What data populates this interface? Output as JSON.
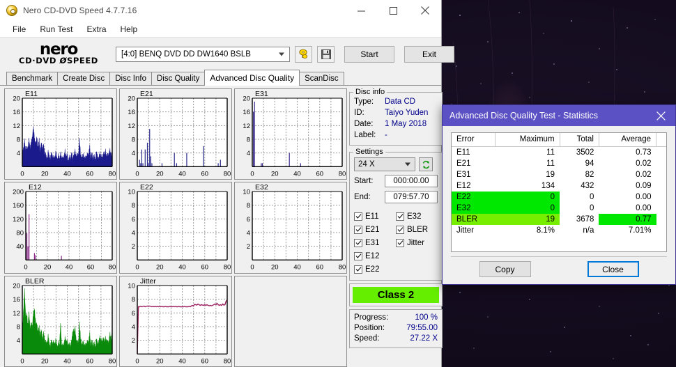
{
  "window": {
    "title": "Nero CD-DVD Speed 4.7.7.16",
    "icon": "nero-disc-icon",
    "minimize": "minimize-icon",
    "maximize": "maximize-icon",
    "close": "close-icon"
  },
  "menu": {
    "items": [
      {
        "label": "File"
      },
      {
        "label": "Run Test"
      },
      {
        "label": "Extra"
      },
      {
        "label": "Help"
      }
    ]
  },
  "logo": {
    "line1": "nero",
    "line2_left": "CD·DVD",
    "line2_right": "SPEED"
  },
  "toolbar": {
    "drive": "[4:0]   BENQ DVD DD DW1640 BSLB",
    "eject_icon": "disc-eject-icon",
    "save_icon": "floppy-save-icon",
    "start_label": "Start",
    "exit_label": "Exit"
  },
  "tabs": [
    {
      "label": "Benchmark",
      "active": false
    },
    {
      "label": "Create Disc",
      "active": false
    },
    {
      "label": "Disc Info",
      "active": false
    },
    {
      "label": "Disc Quality",
      "active": false
    },
    {
      "label": "Advanced Disc Quality",
      "active": true
    },
    {
      "label": "ScanDisc",
      "active": false
    }
  ],
  "disc_info": {
    "legend": "Disc info",
    "type_label": "Type:",
    "type_value": "Data CD",
    "id_label": "ID:",
    "id_value": "Taiyo Yuden",
    "date_label": "Date:",
    "date_value": "1 May 2018",
    "label_label": "Label:",
    "label_value": "-"
  },
  "settings": {
    "legend": "Settings",
    "speed": "24 X",
    "refresh_icon": "refresh-icon",
    "start_label": "Start:",
    "start_value": "000:00.00",
    "end_label": "End:",
    "end_value": "079:57.70",
    "checks_left": [
      {
        "label": "E11",
        "checked": true
      },
      {
        "label": "E21",
        "checked": true
      },
      {
        "label": "E31",
        "checked": true
      },
      {
        "label": "E12",
        "checked": true
      },
      {
        "label": "E22",
        "checked": true
      }
    ],
    "checks_right": [
      {
        "label": "E32",
        "checked": true
      },
      {
        "label": "BLER",
        "checked": true
      },
      {
        "label": "Jitter",
        "checked": true
      }
    ]
  },
  "class_badge": {
    "label": "Class 2",
    "color": "#66ee00"
  },
  "status": {
    "progress_label": "Progress:",
    "progress_value": "100 %",
    "position_label": "Position:",
    "position_value": "79:55.00",
    "speed_label": "Speed:",
    "speed_value": "27.22 X"
  },
  "dialog": {
    "title": "Advanced Disc Quality Test - Statistics",
    "close_icon": "close-icon",
    "title_color": "#5b51c4",
    "columns": [
      "Error",
      "Maximum",
      "Total",
      "Average"
    ],
    "rows": [
      {
        "error": "E11",
        "maximum": "11",
        "total": "3502",
        "average": "0.73",
        "highlight": "none"
      },
      {
        "error": "E21",
        "maximum": "11",
        "total": "94",
        "average": "0.02",
        "highlight": "none"
      },
      {
        "error": "E31",
        "maximum": "19",
        "total": "82",
        "average": "0.02",
        "highlight": "none"
      },
      {
        "error": "E12",
        "maximum": "134",
        "total": "432",
        "average": "0.09",
        "highlight": "none"
      },
      {
        "error": "E22",
        "maximum": "0",
        "total": "0",
        "average": "0.00",
        "highlight": "green"
      },
      {
        "error": "E32",
        "maximum": "0",
        "total": "0",
        "average": "0.00",
        "highlight": "green"
      },
      {
        "error": "BLER",
        "maximum": "19",
        "total": "3678",
        "average": "0.77",
        "highlight": "yellowgreen"
      },
      {
        "error": "Jitter",
        "maximum": "8.1%",
        "total": "n/a",
        "average": "7.01%",
        "highlight": "none"
      }
    ],
    "copy_label": "Copy",
    "close_label": "Close",
    "highlight_green": "#00e800",
    "highlight_yellowgreen": "#77ee00"
  },
  "chart_data": [
    {
      "type": "area",
      "title": "E11",
      "color": "#1a1a8c",
      "xlabel": "",
      "ylabel": "",
      "xlim": [
        0,
        80
      ],
      "ylim": [
        0,
        20
      ],
      "xticks": [
        0,
        20,
        40,
        60,
        80
      ],
      "yticks": [
        4,
        8,
        12,
        16,
        20
      ],
      "grid": true,
      "x": [
        0,
        1,
        2,
        3,
        4,
        5,
        6,
        7,
        8,
        9,
        10,
        11,
        12,
        13,
        14,
        15,
        16,
        17,
        18,
        19,
        20,
        21,
        22,
        23,
        24,
        25,
        26,
        27,
        28,
        29,
        30,
        31,
        32,
        33,
        34,
        35,
        36,
        37,
        38,
        39,
        40,
        41,
        42,
        43,
        44,
        45,
        46,
        47,
        48,
        49,
        50,
        51,
        52,
        53,
        54,
        55,
        56,
        57,
        58,
        59,
        60,
        61,
        62,
        63,
        64,
        65,
        66,
        67,
        68,
        69,
        70,
        71,
        72,
        73,
        74,
        75,
        76,
        77,
        78,
        79,
        80
      ],
      "values": [
        3,
        5,
        8,
        4,
        6,
        5,
        8,
        5,
        7,
        9,
        11,
        8,
        6,
        9,
        5,
        8,
        4,
        7,
        5,
        6,
        4,
        3,
        2,
        4,
        3,
        2,
        4,
        3,
        2,
        3,
        4,
        2,
        3,
        2,
        4,
        2,
        3,
        2,
        5,
        2,
        4,
        1,
        3,
        2,
        4,
        2,
        3,
        5,
        2,
        4,
        3,
        8,
        3,
        2,
        4,
        2,
        3,
        2,
        4,
        3,
        6,
        2,
        4,
        2,
        3,
        2,
        4,
        3,
        2,
        4,
        3,
        2,
        4,
        3,
        5,
        2,
        4,
        3,
        5,
        3,
        4
      ]
    },
    {
      "type": "impulse",
      "title": "E21",
      "color": "#2a2a8c",
      "xlabel": "",
      "ylabel": "",
      "xlim": [
        0,
        80
      ],
      "ylim": [
        0,
        20
      ],
      "xticks": [
        0,
        20,
        40,
        60,
        80
      ],
      "yticks": [
        4,
        8,
        12,
        16,
        20
      ],
      "grid": true,
      "points": [
        [
          2,
          2
        ],
        [
          3,
          1
        ],
        [
          4,
          5
        ],
        [
          5,
          1
        ],
        [
          7,
          5
        ],
        [
          9,
          7
        ],
        [
          10,
          1
        ],
        [
          11,
          11
        ],
        [
          12,
          3
        ],
        [
          13,
          1
        ],
        [
          22,
          1
        ],
        [
          33,
          4
        ],
        [
          35,
          1
        ],
        [
          44,
          4
        ],
        [
          59,
          6
        ],
        [
          72,
          1
        ],
        [
          74,
          2
        ]
      ]
    },
    {
      "type": "impulse",
      "title": "E31",
      "color": "#3a2a8c",
      "xlabel": "",
      "ylabel": "",
      "xlim": [
        0,
        80
      ],
      "ylim": [
        0,
        20
      ],
      "xticks": [
        0,
        20,
        40,
        60,
        80
      ],
      "yticks": [
        4,
        8,
        12,
        16,
        20
      ],
      "grid": true,
      "points": [
        [
          1,
          16
        ],
        [
          2,
          19
        ],
        [
          8,
          1
        ],
        [
          9,
          1
        ],
        [
          33,
          4
        ],
        [
          43,
          1
        ]
      ]
    },
    {
      "type": "impulse",
      "title": "E12",
      "color": "#8a2a8a",
      "xlabel": "",
      "ylabel": "",
      "xlim": [
        0,
        80
      ],
      "ylim": [
        0,
        200
      ],
      "xticks": [
        0,
        20,
        40,
        60,
        80
      ],
      "yticks": [
        40,
        80,
        120,
        160,
        200
      ],
      "grid": true,
      "points": [
        [
          1,
          78
        ],
        [
          2,
          40
        ],
        [
          3,
          134
        ],
        [
          8,
          20
        ],
        [
          9,
          14
        ],
        [
          33,
          12
        ]
      ]
    },
    {
      "type": "impulse",
      "title": "E22",
      "color": "#8a2a8a",
      "xlabel": "",
      "ylabel": "",
      "xlim": [
        0,
        80
      ],
      "ylim": [
        0,
        10
      ],
      "xticks": [
        0,
        20,
        40,
        60,
        80
      ],
      "yticks": [
        2,
        4,
        6,
        8,
        10
      ],
      "grid": true,
      "points": []
    },
    {
      "type": "impulse",
      "title": "E32",
      "color": "#8a2a8a",
      "xlabel": "",
      "ylabel": "",
      "xlim": [
        0,
        80
      ],
      "ylim": [
        0,
        10
      ],
      "xticks": [
        0,
        20,
        40,
        60,
        80
      ],
      "yticks": [
        2,
        4,
        6,
        8,
        10
      ],
      "grid": true,
      "points": []
    },
    {
      "type": "area",
      "title": "BLER",
      "color": "#0a8a0a",
      "xlabel": "",
      "ylabel": "",
      "xlim": [
        0,
        80
      ],
      "ylim": [
        0,
        20
      ],
      "xticks": [
        0,
        20,
        40,
        60,
        80
      ],
      "yticks": [
        4,
        8,
        12,
        16,
        20
      ],
      "grid": true,
      "x": [
        0,
        1,
        2,
        3,
        4,
        5,
        6,
        7,
        8,
        9,
        10,
        11,
        12,
        13,
        14,
        15,
        16,
        17,
        18,
        19,
        20,
        21,
        22,
        23,
        24,
        25,
        26,
        27,
        28,
        29,
        30,
        31,
        32,
        33,
        34,
        35,
        36,
        37,
        38,
        39,
        40,
        41,
        42,
        43,
        44,
        45,
        46,
        47,
        48,
        49,
        50,
        51,
        52,
        53,
        54,
        55,
        56,
        57,
        58,
        59,
        60,
        61,
        62,
        63,
        64,
        65,
        66,
        67,
        68,
        69,
        70,
        71,
        72,
        73,
        74,
        75,
        76,
        77,
        78,
        79,
        80
      ],
      "values": [
        4,
        12,
        19,
        10,
        12,
        8,
        12,
        7,
        9,
        8,
        12,
        13,
        8,
        9,
        6,
        8,
        5,
        7,
        4,
        6,
        4,
        3,
        3,
        5,
        3,
        2,
        4,
        3,
        3,
        3,
        4,
        2,
        3,
        2,
        9,
        2,
        3,
        2,
        5,
        3,
        4,
        2,
        3,
        2,
        4,
        7,
        6,
        8,
        3,
        4,
        3,
        9,
        4,
        2,
        4,
        2,
        3,
        2,
        4,
        3,
        6,
        2,
        4,
        2,
        3,
        2,
        4,
        3,
        3,
        5,
        4,
        3,
        5,
        3,
        5,
        3,
        4,
        3,
        6,
        4,
        6
      ]
    },
    {
      "type": "line",
      "title": "Jitter",
      "color": "#9c2060",
      "xlabel": "",
      "ylabel": "",
      "xlim": [
        0,
        80
      ],
      "ylim": [
        0,
        10
      ],
      "xticks": [
        0,
        20,
        40,
        60,
        80
      ],
      "yticks": [
        2,
        4,
        6,
        8,
        10
      ],
      "grid": true,
      "x": [
        0,
        1,
        2,
        3,
        4,
        5,
        6,
        7,
        8,
        9,
        10,
        11,
        12,
        13,
        14,
        15,
        16,
        17,
        18,
        19,
        20,
        21,
        22,
        23,
        24,
        25,
        26,
        27,
        28,
        29,
        30,
        31,
        32,
        33,
        34,
        35,
        36,
        37,
        38,
        39,
        40,
        41,
        42,
        43,
        44,
        45,
        46,
        47,
        48,
        49,
        50,
        51,
        52,
        53,
        54,
        55,
        56,
        57,
        58,
        59,
        60,
        61,
        62,
        63,
        64,
        65,
        66,
        67,
        68,
        69,
        70,
        71,
        72,
        73,
        74,
        75,
        76,
        77,
        78,
        79,
        80
      ],
      "values": [
        0,
        6.9,
        6.9,
        6.95,
        6.9,
        6.95,
        7.0,
        6.9,
        6.95,
        7.0,
        6.95,
        7.0,
        6.95,
        6.9,
        6.95,
        6.9,
        6.95,
        6.9,
        6.95,
        6.9,
        6.95,
        6.9,
        6.95,
        6.9,
        6.9,
        6.95,
        6.9,
        6.9,
        6.9,
        6.95,
        6.9,
        6.9,
        6.95,
        6.9,
        6.95,
        6.9,
        6.9,
        6.95,
        6.9,
        6.9,
        6.9,
        6.9,
        6.95,
        6.9,
        6.9,
        6.9,
        6.95,
        6.9,
        7.0,
        7.1,
        7.0,
        7.25,
        7.2,
        7.15,
        7.3,
        7.2,
        7.1,
        7.2,
        7.15,
        7.1,
        7.2,
        7.1,
        7.2,
        7.1,
        7.05,
        7.1,
        7.05,
        7.1,
        7.2,
        7.3,
        7.2,
        7.4,
        7.2,
        7.1,
        7.2,
        7.1,
        7.3,
        7.15,
        7.2,
        7.7,
        7.9
      ]
    }
  ]
}
